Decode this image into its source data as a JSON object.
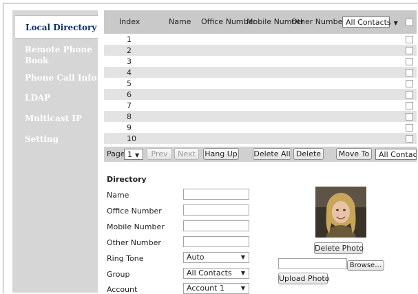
{
  "sidebar": {
    "items": [
      {
        "label": "Local Directory",
        "active": true
      },
      {
        "label": "Remote Phone Book",
        "active": false
      },
      {
        "label": "Phone Call Info",
        "active": false
      },
      {
        "label": "LDAP",
        "active": false
      },
      {
        "label": "Multicast IP",
        "active": false
      },
      {
        "label": "Setting",
        "active": false
      }
    ]
  },
  "table": {
    "headers": {
      "index": "Index",
      "name": "Name",
      "office_number": "Office Number",
      "mobile_number": "Mobile Number",
      "other_number": "Other Number"
    },
    "group_filter": "All Contacts",
    "rows": [
      "1",
      "2",
      "3",
      "4",
      "5",
      "6",
      "7",
      "8",
      "9",
      "10"
    ]
  },
  "pager": {
    "page_label": "Page",
    "page_value": "1",
    "prev": "Prev",
    "next": "Next",
    "hang_up": "Hang Up",
    "delete_all": "Delete All",
    "delete": "Delete",
    "move_to": "Move To",
    "move_target": "All Contact"
  },
  "form": {
    "title": "Directory",
    "name_label": "Name",
    "office_label": "Office Number",
    "mobile_label": "Mobile Number",
    "other_label": "Other Number",
    "ring_tone_label": "Ring Tone",
    "ring_tone_value": "Auto",
    "group_label": "Group",
    "group_value": "All Contacts",
    "account_label": "Account",
    "account_value": "Account 1"
  },
  "photo_panel": {
    "delete_photo": "Delete Photo",
    "browse": "Browse…",
    "upload_photo": "Upload Photo"
  },
  "colors": {
    "active_nav_text": "#0c2d6b",
    "sidebar_bg": "#d6d6d6",
    "header_bg": "#c9c9c9",
    "row_alt_bg": "#e3e3e3"
  }
}
